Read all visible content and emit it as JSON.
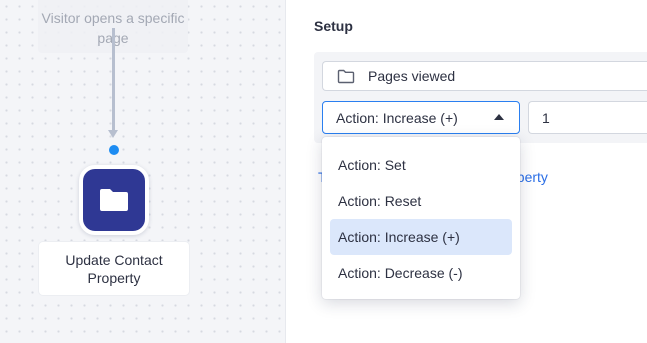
{
  "workflow": {
    "trigger_label": "Visitor opens a specific page",
    "action_label": "Update Contact Property",
    "action_icon": "folder-icon",
    "action_color": "#2f3894",
    "connector_dot_color": "#1d8cf2"
  },
  "setup": {
    "title": "Setup",
    "property_field": {
      "icon": "folder-outline-icon",
      "value": "Pages viewed"
    },
    "action_select": {
      "value": "Action: Increase (+)",
      "expanded": true
    },
    "amount_field": {
      "value": "1"
    },
    "link_left": "T",
    "link_right": "operty",
    "dropdown": {
      "options": [
        "Action: Set",
        "Action: Reset",
        "Action: Increase (+)",
        "Action: Decrease (-)"
      ],
      "selected_index": 2
    }
  },
  "colors": {
    "accent": "#2a7ff0",
    "selected_bg": "#dbe7fb",
    "link": "#2a6ee6"
  }
}
